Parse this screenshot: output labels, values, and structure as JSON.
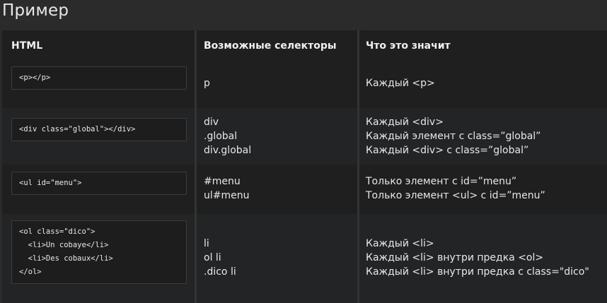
{
  "page": {
    "title": "Пример"
  },
  "table": {
    "headers": [
      "HTML",
      "Возможные селекторы",
      "Что это значит"
    ],
    "rows": [
      {
        "html": [
          "<p></p>"
        ],
        "selectors": [
          "p"
        ],
        "meanings": [
          "Каждый <p>"
        ]
      },
      {
        "html": [
          "<div class=\"global\"></div>"
        ],
        "selectors": [
          "div",
          ".global",
          "div.global"
        ],
        "meanings": [
          "Каждый <div>",
          "Каждый элемент с class=”global”",
          "Каждый <div> с class=”global”"
        ]
      },
      {
        "html": [
          "<ul id=\"menu\">"
        ],
        "selectors": [
          "#menu",
          "ul#menu"
        ],
        "meanings": [
          "Только элемент с id=”menu”",
          "Только элемент <ul> с id=”menu”"
        ]
      },
      {
        "html": [
          "<ol class=\"dico\">",
          "  <li>Un cobaye</li>",
          "  <li>Des cobaux</li>",
          "</ol>"
        ],
        "selectors": [
          "li",
          "ol li",
          ".dico li"
        ],
        "meanings": [
          "Каждый <li>",
          "Каждый <li> внутри предка <ol>",
          "Каждый <li> внутри предка с class=\"dico\""
        ]
      }
    ]
  }
}
